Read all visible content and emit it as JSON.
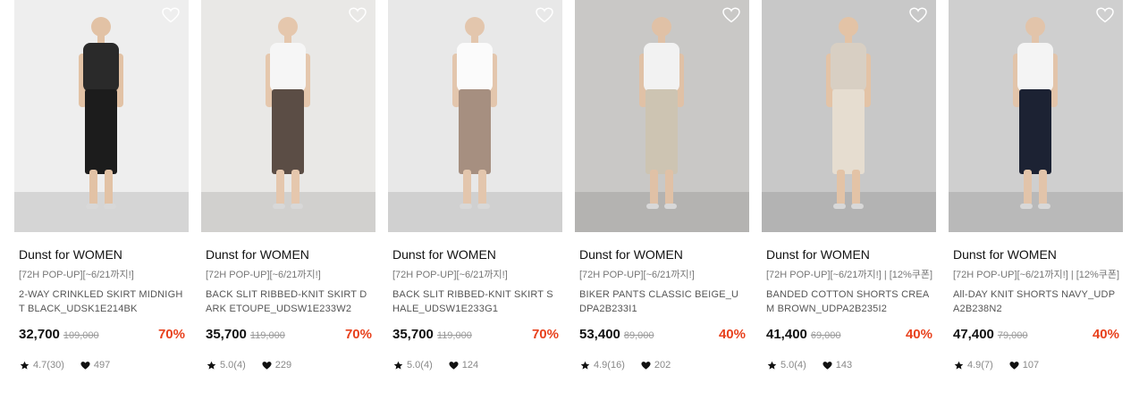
{
  "products": [
    {
      "brand": "Dunst for WOMEN",
      "promo": "[72H POP-UP][~6/21까지!]",
      "name": "2-WAY CRINKLED SKIRT MIDNIGHT BLACK_UDSK1E214BK",
      "price": "32,700",
      "original_price": "109,000",
      "discount": "70%",
      "rating": "4.7(30)",
      "likes": "497",
      "bg": "#eeeeee",
      "top": "#2a2a2a",
      "bottom": "#1c1c1c",
      "skin": "#e2c2a5"
    },
    {
      "brand": "Dunst for WOMEN",
      "promo": "[72H POP-UP][~6/21까지!]",
      "name": "BACK SLIT RIBBED-KNIT SKIRT DARK ETOUPE_UDSW1E233W2",
      "price": "35,700",
      "original_price": "119,000",
      "discount": "70%",
      "rating": "5.0(4)",
      "likes": "229",
      "bg": "#e9e8e6",
      "top": "#f6f6f6",
      "bottom": "#5b4d45",
      "skin": "#e5c7ad"
    },
    {
      "brand": "Dunst for WOMEN",
      "promo": "[72H POP-UP][~6/21까지!]",
      "name": "BACK SLIT RIBBED-KNIT SKIRT SHALE_UDSW1E233G1",
      "price": "35,700",
      "original_price": "119,000",
      "discount": "70%",
      "rating": "5.0(4)",
      "likes": "124",
      "bg": "#e8e8e8",
      "top": "#fbfbfb",
      "bottom": "#a68f80",
      "skin": "#e3c6ad"
    },
    {
      "brand": "Dunst for WOMEN",
      "promo": "[72H POP-UP][~6/21까지!]",
      "name": "BIKER PANTS CLASSIC BEIGE_UDPA2B233I1",
      "price": "53,400",
      "original_price": "89,000",
      "discount": "40%",
      "rating": "4.9(16)",
      "likes": "202",
      "bg": "#c9c8c6",
      "top": "#f2f2f2",
      "bottom": "#cdc4b2",
      "skin": "#e0c1a6"
    },
    {
      "brand": "Dunst for WOMEN",
      "promo": "[72H POP-UP][~6/21까지!] | [12%쿠폰]",
      "name": "BANDED COTTON SHORTS CREAM BROWN_UDPA2B235I2",
      "price": "41,400",
      "original_price": "69,000",
      "discount": "40%",
      "rating": "5.0(4)",
      "likes": "143",
      "bg": "#c8c8c8",
      "top": "#d8cfc3",
      "bottom": "#e6ddd0",
      "skin": "#e3c3a6"
    },
    {
      "brand": "Dunst for WOMEN",
      "promo": "[72H POP-UP][~6/21까지!] | [12%쿠폰]",
      "name": "All-DAY KNIT SHORTS NAVY_UDPA2B238N2",
      "price": "47,400",
      "original_price": "79,000",
      "discount": "40%",
      "rating": "4.9(7)",
      "likes": "107",
      "bg": "#cfcfcf",
      "top": "#f4f4f4",
      "bottom": "#1c2233",
      "skin": "#e2c4aa"
    }
  ],
  "colors": {
    "discount": "#e8411d",
    "price": "#111111",
    "muted": "#888888"
  },
  "icons": {
    "wishlist": "heart-outline-icon",
    "rating": "star-icon",
    "likes": "heart-filled-icon"
  }
}
